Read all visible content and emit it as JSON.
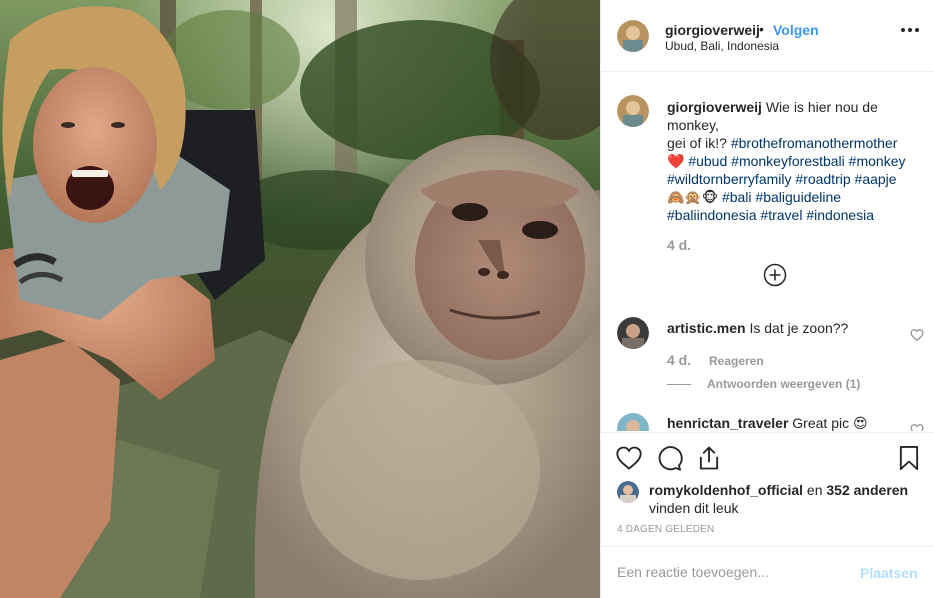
{
  "post": {
    "username": "giorgioverweij",
    "separator": "•",
    "follow_label": "Volgen",
    "location": "Ubud, Bali, Indonesia",
    "more_icon": "more-horizontal-icon"
  },
  "caption": {
    "username": "giorgioverweij",
    "line1": "Wie is hier nou de",
    "line2": "monkey,",
    "line3": "gei of ik!?",
    "tag_brothe": "#brothefromanothermother",
    "heart": "❤️",
    "tag_ubud": "#ubud",
    "tag_monkeyforest": "#monkeyforestbali",
    "tag_monkey": "#monkey",
    "tag_wildtornberry": "#wildtornberryfamily",
    "tag_roadtrip": "#roadtrip",
    "tag_aapje": "#aapje",
    "emojis": "🙈🙊🐵",
    "tag_bali": "#bali",
    "tag_baliguideline": "#baliguideline",
    "tag_baliindonesia": "#baliindonesia",
    "tag_travel": "#travel",
    "tag_indonesia": "#indonesia",
    "time": "4 d."
  },
  "comments": [
    {
      "username": "artistic.men",
      "text": "Is dat je zoon??",
      "time": "4 d.",
      "reply_label": "Reageren",
      "view_replies_label": "Antwoorden weergeven (1)"
    },
    {
      "username": "henrictan_traveler",
      "text": "Great pic 😍"
    }
  ],
  "likes": {
    "user": "romykoldenhof_official",
    "connector": "en",
    "others": "352 anderen",
    "suffix": "vinden dit leuk"
  },
  "timestamp": "4 DAGEN GELEDEN",
  "add_comment": {
    "placeholder": "Een reactie toevoegen...",
    "post_label": "Plaatsen"
  },
  "colors": {
    "link_blue": "#3897f0",
    "hashtag_blue": "#003569",
    "muted_gray": "#999999",
    "disabled_post_blue": "#b2dffc"
  }
}
